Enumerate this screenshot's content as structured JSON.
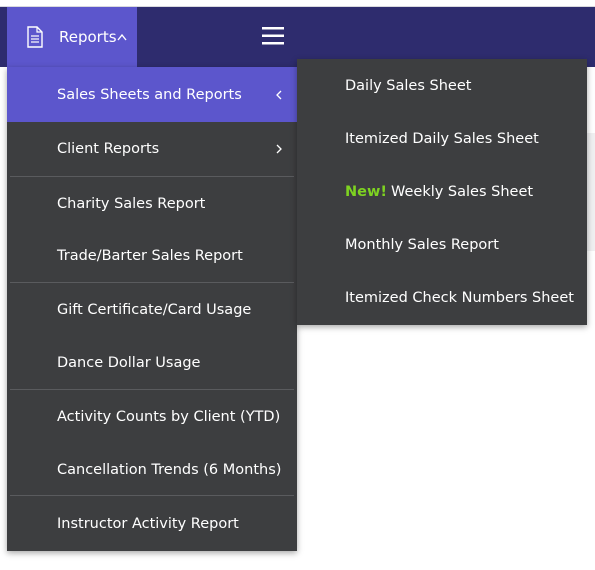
{
  "navbar": {
    "reports_label": "Reports",
    "reports_icon": "document-icon",
    "chevron_icon": "chevron-up-icon",
    "menu_icon": "hamburger-icon",
    "bg_color": "#2e2c6e",
    "accent_color": "#5c56cc"
  },
  "menu": {
    "items": [
      {
        "label": "Sales Sheets and Reports",
        "arrow": "chevron-left-icon",
        "active": true
      },
      {
        "label": "Client Reports",
        "arrow": "chevron-right-icon"
      },
      {
        "label": "Charity Sales Report"
      },
      {
        "label": "Trade/Barter Sales Report"
      },
      {
        "label": "Gift Certificate/Card Usage"
      },
      {
        "label": "Dance Dollar Usage"
      },
      {
        "label": "Activity Counts by Client (YTD)"
      },
      {
        "label": "Cancellation Trends (6 Months)"
      },
      {
        "label": "Instructor Activity Report"
      }
    ],
    "bg_color": "#3d3e40"
  },
  "submenu": {
    "items": [
      {
        "label": "Daily Sales Sheet"
      },
      {
        "label": "Itemized Daily Sales Sheet"
      },
      {
        "badge": "New!",
        "label": "Weekly Sales Sheet"
      },
      {
        "label": "Monthly Sales Report"
      },
      {
        "label": "Itemized Check Numbers Sheet"
      }
    ],
    "badge_color": "#7ed321"
  }
}
